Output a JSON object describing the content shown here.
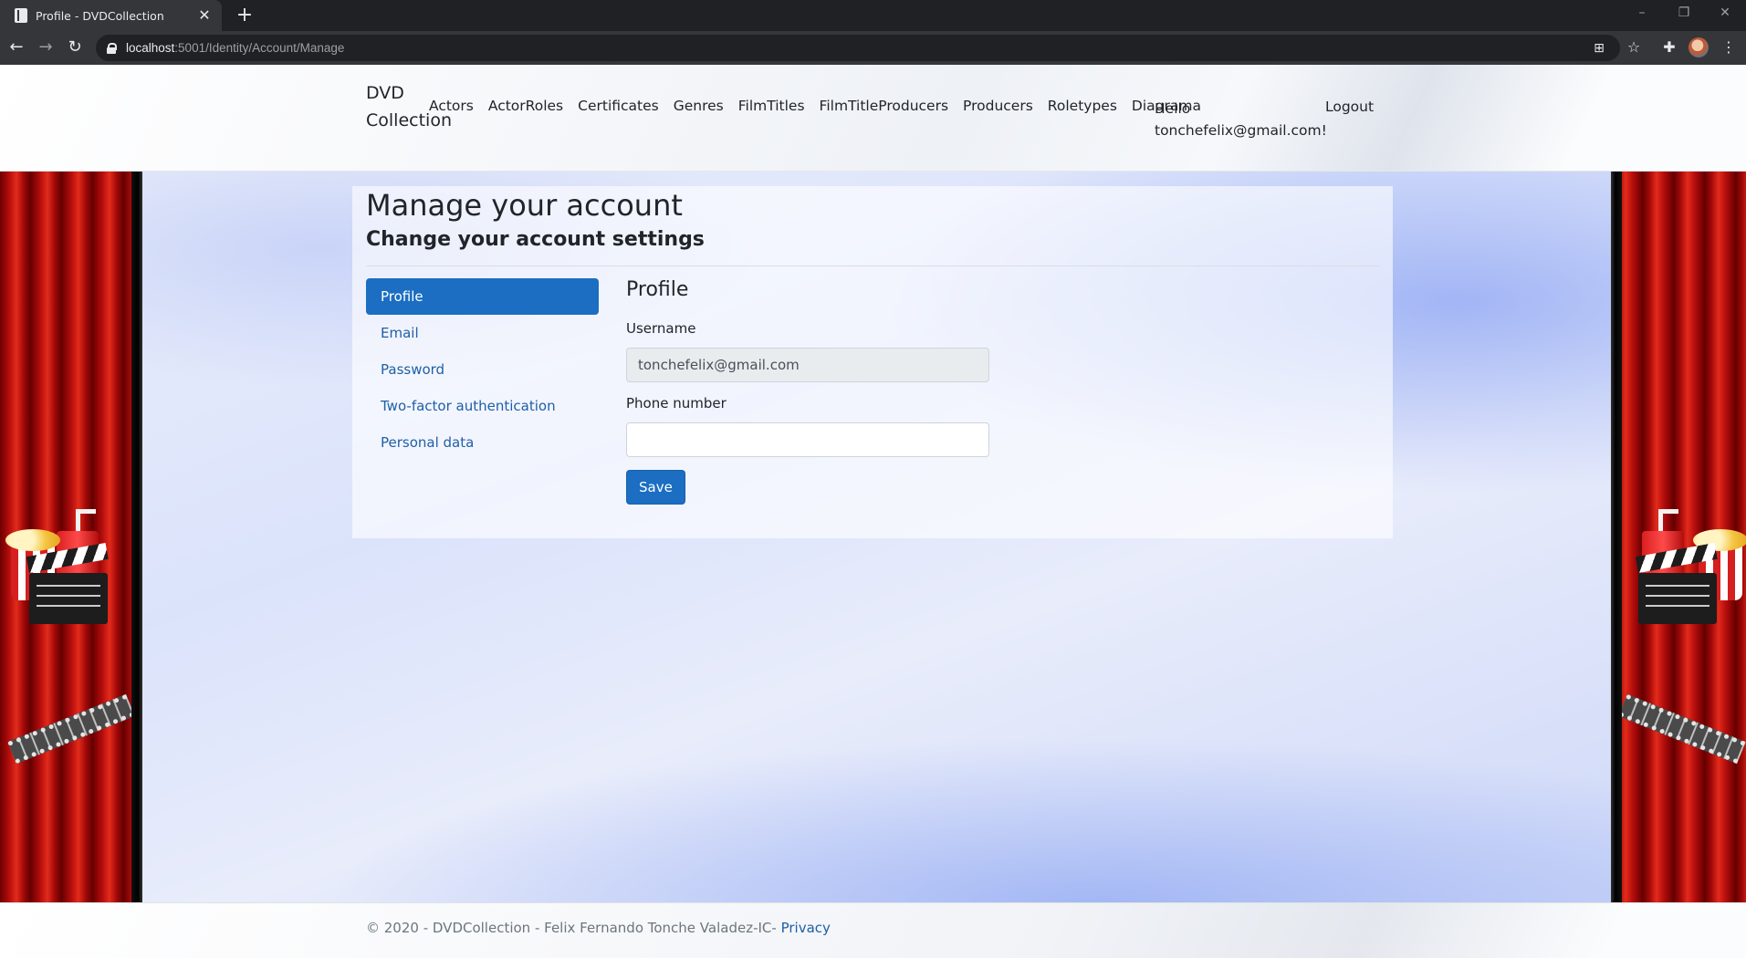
{
  "browser": {
    "tab_title": "Profile - DVDCollection",
    "tab_close": "✕",
    "new_tab": "+",
    "url_host": "localhost",
    "url_rest": ":5001/Identity/Account/Manage",
    "window_controls": [
      "–",
      "❐",
      "✕"
    ]
  },
  "site": {
    "brand": "DVD Collection",
    "nav_items": [
      "Actors",
      "ActorRoles",
      "Certificates",
      "Genres",
      "FilmTitles",
      "FilmTitleProducers",
      "Producers",
      "Roletypes",
      "Diagrama"
    ],
    "hello_line1": "Hello",
    "hello_line2": "tonchefelix@gmail.com!",
    "logout": "Logout"
  },
  "main": {
    "title": "Manage your account",
    "subtitle": "Change your account settings",
    "sidenav": [
      "Profile",
      "Email",
      "Password",
      "Two-factor authentication",
      "Personal data"
    ],
    "active_sidenav_index": 0,
    "form": {
      "heading": "Profile",
      "username_label": "Username",
      "username_value": "tonchefelix@gmail.com",
      "phone_label": "Phone number",
      "phone_value": "",
      "save_label": "Save"
    }
  },
  "footer": {
    "text": "© 2020 - DVDCollection - Felix Fernando Tonche Valadez-IC-",
    "privacy": "Privacy"
  },
  "colors": {
    "primary": "#1b6ec2",
    "link": "#1f5fa6",
    "curtain_red": "#c81414"
  }
}
